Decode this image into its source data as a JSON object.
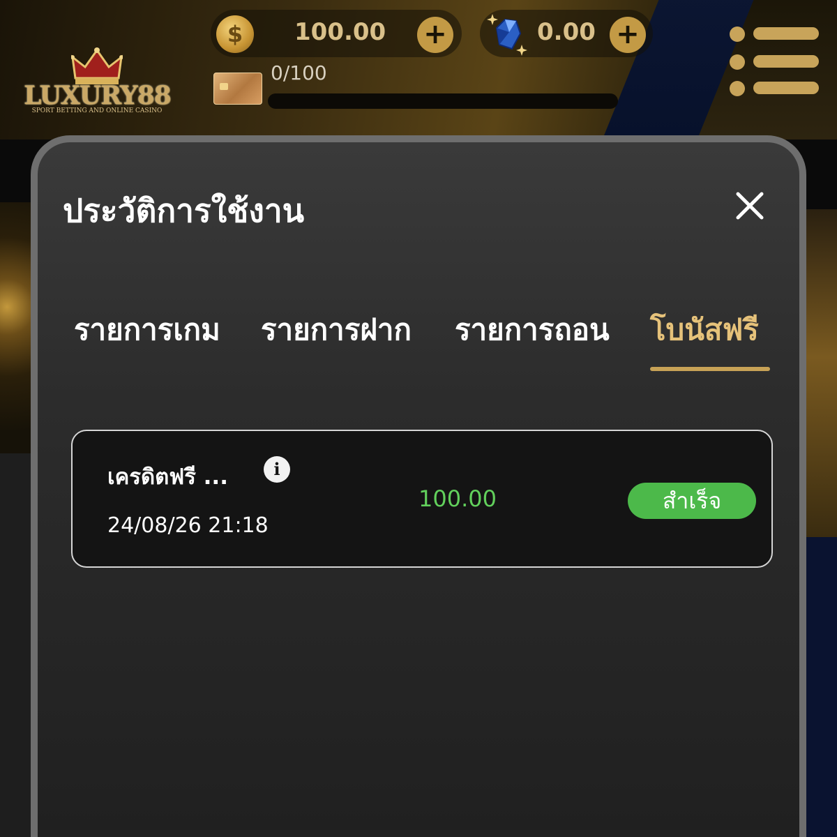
{
  "header": {
    "logo_text": "LUXURY88",
    "logo_subtitle": "SPORT BETTING AND ONLINE CASINO",
    "coin_balance": "100.00",
    "gem_balance": "0.00",
    "plus_symbol": "+",
    "progress_label": "0/100",
    "progress_fraction": 0,
    "coin_icon_glyph": "$",
    "icons": [
      "coin-icon",
      "gem-icon",
      "credit-card-icon",
      "menu-icon"
    ]
  },
  "modal": {
    "title": "ประวัติการใช้งาน",
    "close_icon": "close-icon",
    "tabs": [
      {
        "label": "รายการเกม",
        "active": false
      },
      {
        "label": "รายการฝาก",
        "active": false
      },
      {
        "label": "รายการถอน",
        "active": false
      },
      {
        "label": "โบนัสฟรี",
        "active": true
      }
    ],
    "records": [
      {
        "name": "เครดิตฟรี ...",
        "info_icon": "i",
        "datetime": "24/08/26 21:18",
        "amount": "100.00",
        "status": "สำเร็จ"
      }
    ]
  },
  "colors": {
    "gold": "#c39a45",
    "active_tab": "#e6c27a",
    "amount_green": "#62d05c",
    "status_green": "#4cb94a"
  }
}
